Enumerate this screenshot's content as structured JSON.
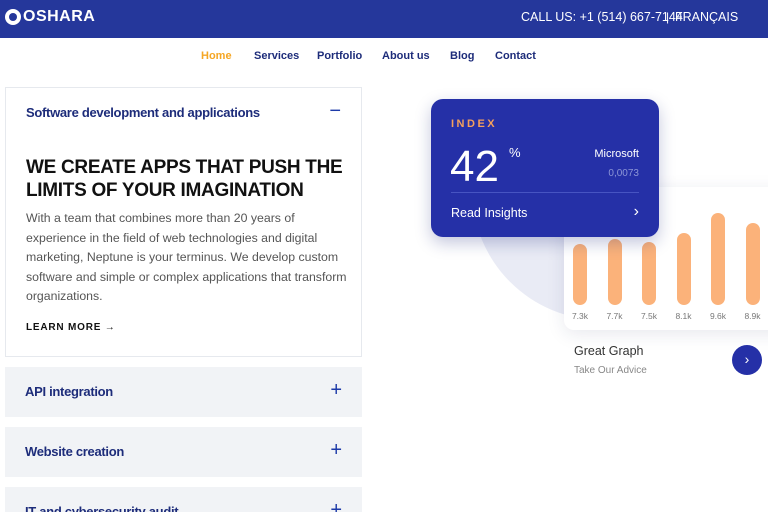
{
  "header": {
    "logo": "OSHARA",
    "call_us": "CALL US: +1 (514) 667-7144",
    "separator": "|",
    "language": "FRANÇAIS"
  },
  "nav": {
    "items": [
      "Home",
      "Services",
      "Portfolio",
      "About us",
      "Blog",
      "Contact"
    ],
    "active": "Home"
  },
  "accordion": {
    "open_item": {
      "title": "Software development and applications",
      "icon": "minus-icon",
      "headline": "WE CREATE APPS THAT PUSH THE LIMITS OF YOUR IMAGINATION",
      "description": "With a team that combines more than 20 years of experience in the field of web technologies and digital marketing, Neptune is your terminus. We develop custom software and simple or complex applications that transform organizations.",
      "learn_more": "LEARN MORE →"
    },
    "closed_items": [
      {
        "title": "API integration",
        "icon": "plus-icon"
      },
      {
        "title": "Website creation",
        "icon": "plus-icon"
      },
      {
        "title": "IT and cybersecurity audit",
        "icon": "plus-icon"
      }
    ]
  },
  "index_card": {
    "label": "INDEX",
    "value": "42",
    "unit": "%",
    "company": "Microsoft",
    "small_value": "0,0073",
    "read_insights": "Read Insights",
    "arrow": "›"
  },
  "graph_card": {
    "bars": [
      {
        "label": "7.3k",
        "value": 7.3
      },
      {
        "label": "7.7k",
        "value": 7.7
      },
      {
        "label": "7.5k",
        "value": 7.5
      },
      {
        "label": "8.1k",
        "value": 8.1
      },
      {
        "label": "9.6k",
        "value": 9.6
      },
      {
        "label": "8.9k",
        "value": 8.9
      }
    ],
    "title": "Great Graph",
    "subtitle": "Take Our Advice",
    "button_arrow": "›"
  },
  "colors": {
    "brand_blue": "#25379b",
    "card_blue": "#2530a7",
    "accent_orange": "#f5a623",
    "bar_orange": "#fbb27a"
  }
}
